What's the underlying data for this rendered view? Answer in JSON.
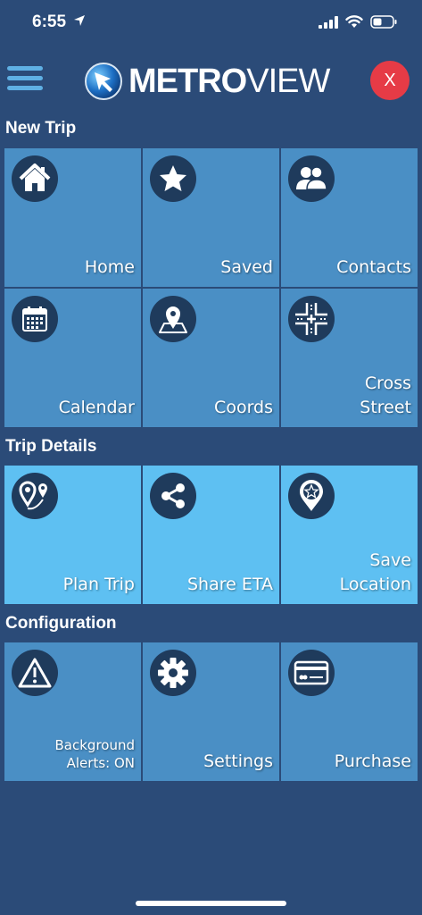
{
  "status": {
    "time": "6:55"
  },
  "header": {
    "logo_bold": "METRO",
    "logo_light": "VIEW",
    "close_label": "X"
  },
  "sections": [
    {
      "title": "New Trip",
      "tiles": [
        {
          "label": "Home",
          "icon": "home-icon"
        },
        {
          "label": "Saved",
          "icon": "star-icon"
        },
        {
          "label": "Contacts",
          "icon": "contacts-icon"
        },
        {
          "label": "Calendar",
          "icon": "calendar-icon"
        },
        {
          "label": "Coords",
          "icon": "map-pin-icon"
        },
        {
          "label": "Cross Street",
          "icon": "cross-street-icon"
        }
      ]
    },
    {
      "title": "Trip Details",
      "tiles": [
        {
          "label": "Plan Trip",
          "icon": "route-icon"
        },
        {
          "label": "Share ETA",
          "icon": "share-icon"
        },
        {
          "label": "Save Location",
          "icon": "save-location-icon"
        }
      ]
    },
    {
      "title": "Configuration",
      "tiles": [
        {
          "label": "Background Alerts: ON",
          "icon": "alert-icon"
        },
        {
          "label": "Settings",
          "icon": "gear-icon"
        },
        {
          "label": "Purchase",
          "icon": "credit-card-icon"
        }
      ]
    }
  ],
  "colors": {
    "background": "#2b4b78",
    "tile": "#4a8fc5",
    "tile_highlight": "#5ec0f2",
    "close": "#e63b46"
  }
}
